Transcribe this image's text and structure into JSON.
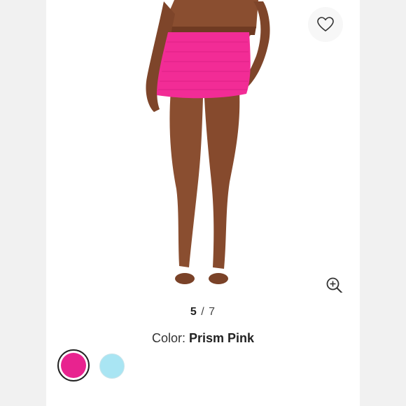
{
  "gallery": {
    "current_index": "5",
    "separator": "/",
    "total": "7"
  },
  "color": {
    "label": "Color:",
    "selected_name": "Prism Pink"
  },
  "swatches": [
    {
      "name": "Prism Pink",
      "hex": "#e8238f",
      "selected": true
    },
    {
      "name": "Light Blue",
      "hex": "#a9e5f3",
      "selected": false
    }
  ],
  "icons": {
    "favorite": "heart-icon",
    "zoom": "zoom-in-icon"
  },
  "colors": {
    "skirt": "#f22c96",
    "skin": "#8a4e30"
  }
}
